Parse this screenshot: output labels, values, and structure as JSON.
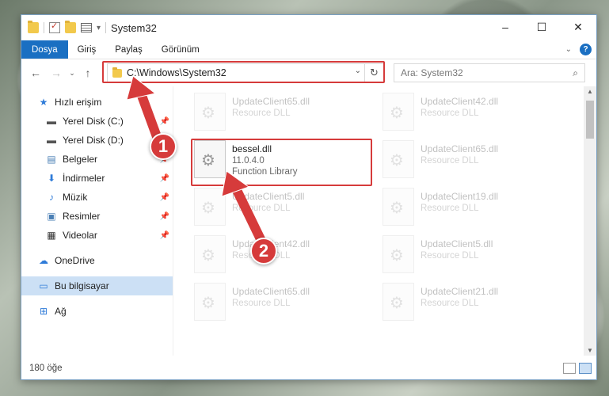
{
  "window": {
    "title": "System32",
    "controls": [
      "–",
      "☐",
      "✕"
    ]
  },
  "ribbon": {
    "tabs": [
      "Dosya",
      "Giriş",
      "Paylaş",
      "Görünüm"
    ]
  },
  "address": {
    "path": "C:\\Windows\\System32",
    "search_placeholder": "Ara: System32"
  },
  "sidebar": {
    "items": [
      {
        "label": "Hızlı erişim",
        "icon": "star-icon",
        "level": 1
      },
      {
        "label": "Yerel Disk (C:)",
        "icon": "drive-icon",
        "level": 2,
        "pinned": true
      },
      {
        "label": "Yerel Disk (D:)",
        "icon": "drive-icon",
        "level": 2,
        "pinned": false
      },
      {
        "label": "Belgeler",
        "icon": "documents-icon",
        "level": 2,
        "pinned": true
      },
      {
        "label": "İndirmeler",
        "icon": "download-icon",
        "level": 2,
        "pinned": true
      },
      {
        "label": "Müzik",
        "icon": "music-icon",
        "level": 2,
        "pinned": true
      },
      {
        "label": "Resimler",
        "icon": "pictures-icon",
        "level": 2,
        "pinned": true
      },
      {
        "label": "Videolar",
        "icon": "videos-icon",
        "level": 2,
        "pinned": true
      },
      {
        "label": "OneDrive",
        "icon": "cloud-icon",
        "level": 1
      },
      {
        "label": "Bu bilgisayar",
        "icon": "computer-icon",
        "level": 1,
        "selected": true
      },
      {
        "label": "Ağ",
        "icon": "network-icon",
        "level": 1
      }
    ]
  },
  "files": {
    "left": [
      {
        "name": "UpdateClient65.dll",
        "type": "Resource DLL"
      },
      {
        "name": "bessel.dll",
        "version": "11.0.4.0",
        "type": "Function Library"
      },
      {
        "name": "UpdateClient5.dll",
        "type": "Resource DLL"
      },
      {
        "name": "UpdateClient42.dll",
        "type": "Resource DLL"
      },
      {
        "name": "UpdateClient65.dll",
        "type": "Resource DLL"
      }
    ],
    "right": [
      {
        "name": "UpdateClient42.dll",
        "type": "Resource DLL"
      },
      {
        "name": "UpdateClient65.dll",
        "type": "Resource DLL"
      },
      {
        "name": "UpdateClient19.dll",
        "type": "Resource DLL"
      },
      {
        "name": "UpdateClient5.dll",
        "type": "Resource DLL"
      },
      {
        "name": "UpdateClient21.dll",
        "type": "Resource DLL"
      }
    ]
  },
  "status": {
    "count": "180 öğe"
  },
  "annotations": {
    "marker1": "1",
    "marker2": "2",
    "color": "#d63b3b"
  }
}
